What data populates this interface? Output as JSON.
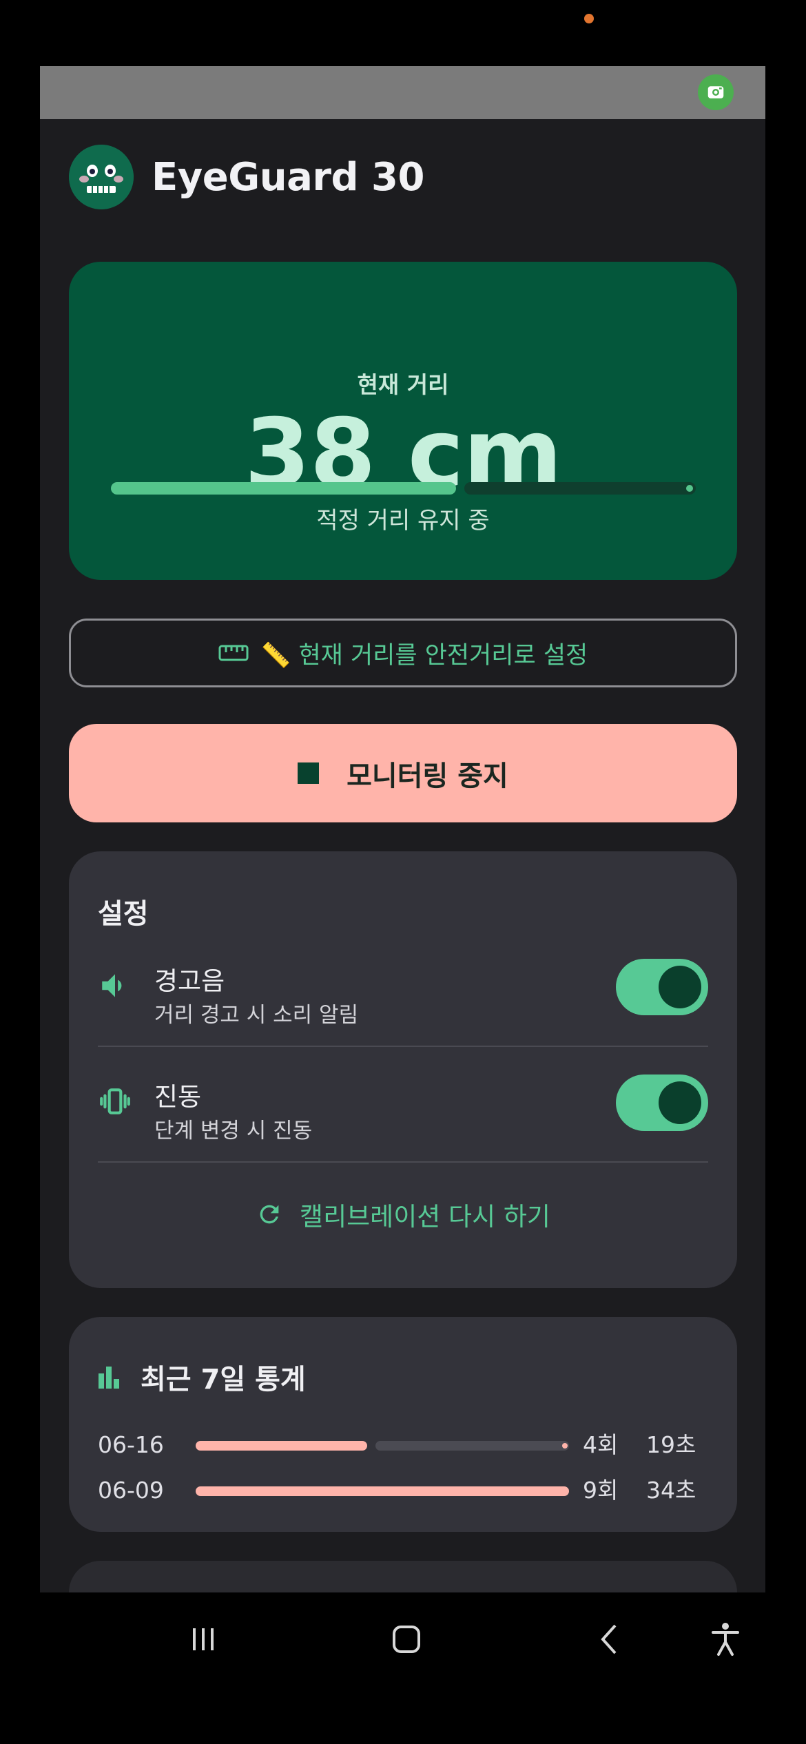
{
  "app": {
    "title": "EyeGuard 30"
  },
  "distance": {
    "label": "현재 거리",
    "value": "38 cm",
    "status": "적정 거리 유지 중",
    "progress_percent": 59
  },
  "actions": {
    "calibrate_label": "📏 현재 거리를 안전거리로 설정",
    "stop_label": "모니터링 중지"
  },
  "settings": {
    "title": "설정",
    "items": [
      {
        "title": "경고음",
        "description": "거리 경고 시 소리 알림",
        "enabled": true,
        "icon": "volume-icon"
      },
      {
        "title": "진동",
        "description": "단계 변경 시 진동",
        "enabled": true,
        "icon": "vibration-icon"
      }
    ],
    "recalibrate_label": "캘리브레이션 다시 하기"
  },
  "stats": {
    "title": "최근 7일 통계",
    "rows": [
      {
        "date": "06-16",
        "count": "4회",
        "time": "19초",
        "bar_fraction": 0.46
      },
      {
        "date": "06-09",
        "count": "9회",
        "time": "34초",
        "bar_fraction": 1.0
      }
    ]
  },
  "colors": {
    "accent": "#57c995",
    "card_green": "#04573b",
    "stop_button": "#ffb4aa",
    "surface": "#33333a"
  }
}
